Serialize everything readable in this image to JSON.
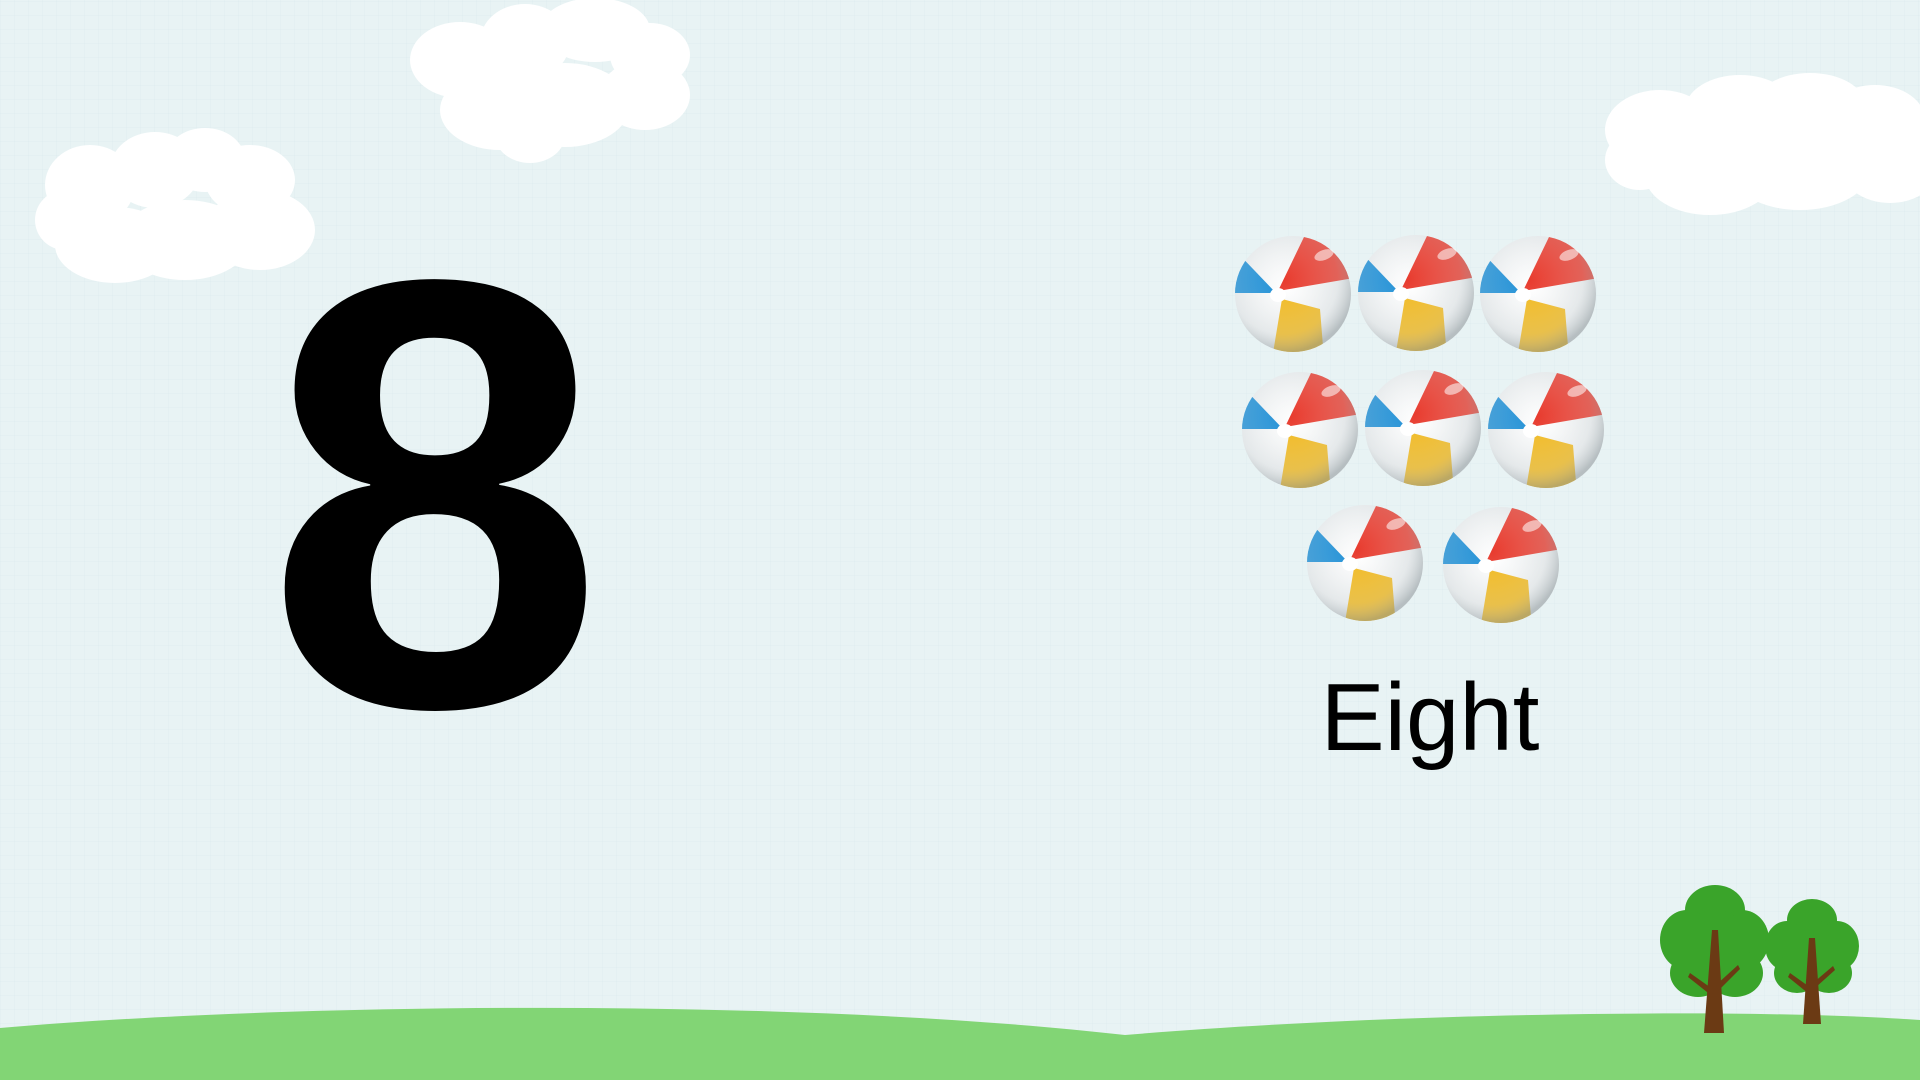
{
  "slide": {
    "numeral": "8",
    "word": "Eight",
    "ball_count": 8
  },
  "icons": {
    "ball": "beach-ball-icon",
    "cloud": "cloud-icon",
    "tree": "tree-icon"
  },
  "colors": {
    "sky": "#e8f3f4",
    "grass": "#82d575",
    "cloud": "#ffffff",
    "ball_red": "#e83b2e",
    "ball_blue": "#1e8fd6",
    "ball_yellow": "#f1b81c",
    "tree_leaves": "#3aa42a",
    "tree_trunk": "#6b3a14"
  }
}
